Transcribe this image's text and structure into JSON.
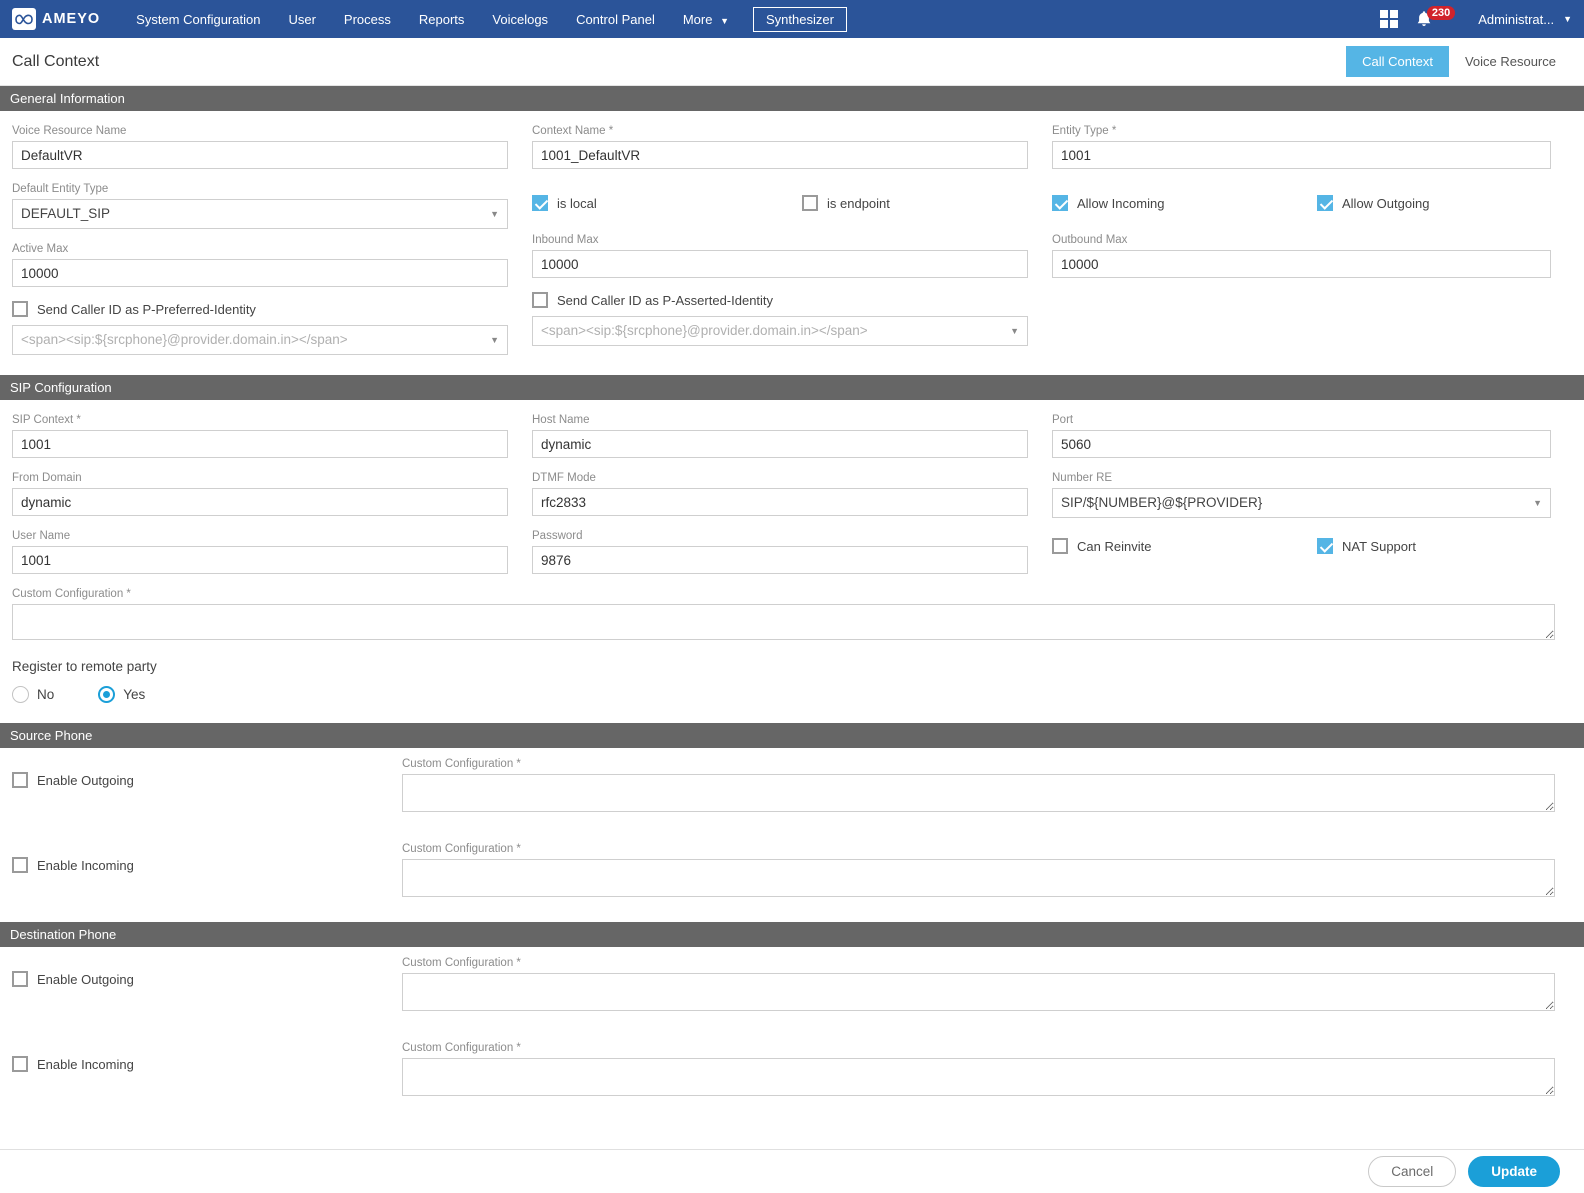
{
  "nav": {
    "logo_text": "AMEYO",
    "logo_icon": "infinity-icon",
    "items": [
      {
        "label": "System Configuration",
        "caret": false
      },
      {
        "label": "User",
        "caret": false
      },
      {
        "label": "Process",
        "caret": false
      },
      {
        "label": "Reports",
        "caret": false
      },
      {
        "label": "Voicelogs",
        "caret": false
      },
      {
        "label": "Control Panel",
        "caret": false
      },
      {
        "label": "More",
        "caret": true
      }
    ],
    "pill_label": "Synthesizer",
    "caret_glyph": "▼",
    "apps_icon": "grid-apps-icon",
    "bell_icon": "🔔",
    "notification_count": "230",
    "user_label": "Administrat...",
    "user_caret": "⌄"
  },
  "titlebar": {
    "title": "Call Context",
    "tabs": [
      {
        "label": "Call Context",
        "active": true
      },
      {
        "label": "Voice Resource",
        "active": false
      }
    ]
  },
  "sections": {
    "general": {
      "heading": "General Information",
      "voice_resource_name": {
        "label": "Voice Resource Name",
        "value": "DefaultVR"
      },
      "context_name": {
        "label": "Context Name *",
        "value": "1001_DefaultVR"
      },
      "entity_type": {
        "label": "Entity Type *",
        "value": "1001"
      },
      "default_entity_type": {
        "label": "Default Entity Type",
        "value": "DEFAULT_SIP"
      },
      "is_local": {
        "label": "is local",
        "checked": true
      },
      "is_endpoint": {
        "label": "is endpoint",
        "checked": false
      },
      "allow_incoming": {
        "label": "Allow Incoming",
        "checked": true
      },
      "allow_outgoing": {
        "label": "Allow Outgoing",
        "checked": true
      },
      "active_max": {
        "label": "Active Max",
        "value": "10000"
      },
      "inbound_max": {
        "label": "Inbound Max",
        "value": "10000"
      },
      "outbound_max": {
        "label": "Outbound Max",
        "value": "10000"
      },
      "preferred_identity": {
        "label": "Send Caller ID as P-Preferred-Identity",
        "checked": false,
        "placeholder": "<span><sip:${srcphone}@provider.domain.in></span>"
      },
      "asserted_identity": {
        "label": "Send Caller ID as P-Asserted-Identity",
        "checked": false,
        "placeholder": "<span><sip:${srcphone}@provider.domain.in></span>"
      }
    },
    "sip": {
      "heading": "SIP Configuration",
      "sip_context": {
        "label": "SIP Context *",
        "value": "1001"
      },
      "host_name": {
        "label": "Host Name",
        "value": "dynamic"
      },
      "port": {
        "label": "Port",
        "value": "5060"
      },
      "from_domain": {
        "label": "From Domain",
        "value": "dynamic"
      },
      "dtmf_mode": {
        "label": "DTMF Mode",
        "value": "rfc2833"
      },
      "number_re": {
        "label": "Number RE",
        "value": "SIP/${NUMBER}@${PROVIDER}"
      },
      "user_name": {
        "label": "User Name",
        "value": "1001"
      },
      "password": {
        "label": "Password",
        "value": "9876"
      },
      "can_reinvite": {
        "label": "Can Reinvite",
        "checked": false
      },
      "nat_support": {
        "label": "NAT Support",
        "checked": true
      },
      "custom_configuration": {
        "label": "Custom Configuration *",
        "value": ""
      },
      "register_remote": {
        "label": "Register to remote party",
        "options": [
          {
            "label": "No",
            "selected": false
          },
          {
            "label": "Yes",
            "selected": true
          }
        ]
      }
    },
    "source_phone": {
      "heading": "Source Phone",
      "enable_outgoing": {
        "label": "Enable Outgoing",
        "checked": false
      },
      "outgoing_custom_configuration": {
        "label": "Custom Configuration *",
        "value": ""
      },
      "enable_incoming": {
        "label": "Enable Incoming",
        "checked": false
      },
      "incoming_custom_configuration": {
        "label": "Custom Configuration *",
        "value": ""
      }
    },
    "destination_phone": {
      "heading": "Destination Phone",
      "enable_outgoing": {
        "label": "Enable Outgoing",
        "checked": false
      },
      "outgoing_custom_configuration": {
        "label": "Custom Configuration *",
        "value": ""
      },
      "enable_incoming": {
        "label": "Enable Incoming",
        "checked": false
      },
      "incoming_custom_configuration": {
        "label": "Custom Configuration *",
        "value": ""
      }
    }
  },
  "footer": {
    "cancel_label": "Cancel",
    "update_label": "Update"
  },
  "colors": {
    "nav_blue": "#2b5499",
    "accent_blue": "#55b5e5",
    "button_blue": "#1b9fd8",
    "section_gray": "#666666",
    "badge_red": "#d0232b"
  }
}
